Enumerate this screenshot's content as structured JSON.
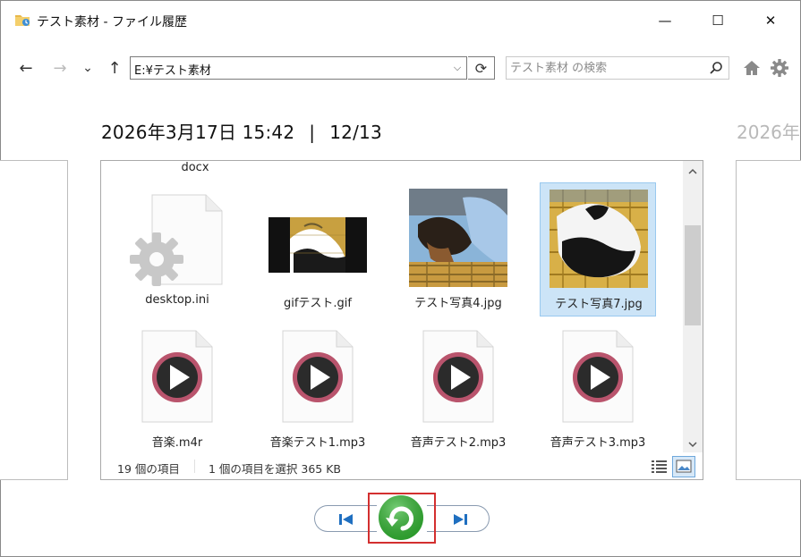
{
  "window": {
    "title": "テスト素材 - ファイル履歴",
    "minimize": "—",
    "maximize": "☐",
    "close": "✕"
  },
  "nav": {
    "back": "←",
    "forward": "→",
    "recent": "⌄",
    "up": "↑",
    "address": "E:¥テスト素材",
    "address_dropdown": "⌵",
    "refresh": "⟳",
    "search_placeholder": "テスト素材 の検索"
  },
  "snapshot": {
    "date": "2026年3月17日 15:42",
    "separator": "|",
    "position": "12/13",
    "next_date_partial": "2026年"
  },
  "files": {
    "partial_top_label": "docx",
    "items": [
      {
        "name": "desktop.ini",
        "type": "settings",
        "selected": false
      },
      {
        "name": "gifテスト.gif",
        "type": "image",
        "selected": false
      },
      {
        "name": "テスト写真4.jpg",
        "type": "image",
        "selected": false
      },
      {
        "name": "テスト写真7.jpg",
        "type": "image",
        "selected": true
      },
      {
        "name": "音楽.m4r",
        "type": "audio",
        "selected": false
      },
      {
        "name": "音楽テスト1.mp3",
        "type": "audio",
        "selected": false
      },
      {
        "name": "音声テスト2.mp3",
        "type": "audio",
        "selected": false
      },
      {
        "name": "音声テスト3.mp3",
        "type": "audio",
        "selected": false
      }
    ]
  },
  "status": {
    "item_count": "19 個の項目",
    "selection": "1 個の項目を選択  365 KB"
  },
  "colors": {
    "selection_bg": "#cce4f7",
    "restore_green": "#2fb52f",
    "highlight_red": "#d32f2f",
    "nav_blue": "#1f6fc0"
  },
  "icons": {
    "app": "folder-history-icon",
    "search": "search-icon",
    "home": "home-icon",
    "settings": "gear-icon",
    "previous": "previous-version-icon",
    "next": "next-version-icon",
    "restore": "restore-icon"
  }
}
